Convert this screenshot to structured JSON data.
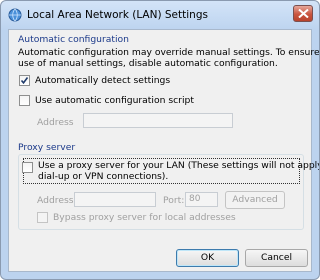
{
  "window": {
    "title": "Local Area Network (LAN) Settings"
  },
  "auto_config": {
    "legend": "Automatic configuration",
    "description_line1": "Automatic configuration may override manual settings.  To ensure the",
    "description_line2": "use of manual settings, disable automatic configuration.",
    "detect_label": "Automatically detect settings",
    "detect_checked": true,
    "script_label": "Use automatic configuration script",
    "script_checked": false,
    "address_label": "Address",
    "address_value": ""
  },
  "proxy": {
    "legend": "Proxy server",
    "use_proxy_line1": "Use a proxy server for your LAN (These settings will not apply to",
    "use_proxy_line2": "dial-up or VPN connections).",
    "use_proxy_checked": false,
    "address_label": "Address:",
    "address_value": "",
    "port_label": "Port:",
    "port_value": "80",
    "advanced_label": "Advanced",
    "bypass_label": "Bypass proxy server for local addresses",
    "bypass_checked": false
  },
  "buttons": {
    "ok": "OK",
    "cancel": "Cancel"
  }
}
